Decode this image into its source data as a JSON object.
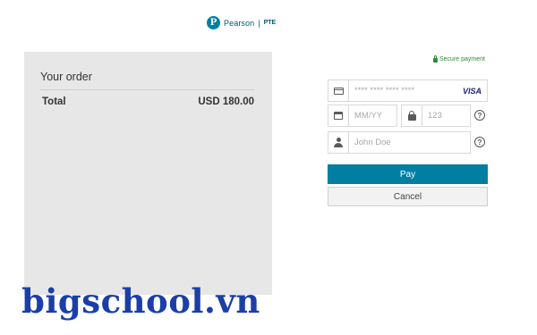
{
  "brand": {
    "logo_letter": "P",
    "name": "Pearson",
    "separator": "|",
    "product": "PTE"
  },
  "order": {
    "title": "Your order",
    "total_label": "Total",
    "total_value": "USD 180.00"
  },
  "payment": {
    "secure_label": "Secure payment",
    "card_placeholder": "**** **** **** ****",
    "card_brand": "VISA",
    "expiry_placeholder": "MM/YY",
    "cvv_placeholder": "123",
    "name_placeholder": "John Doe",
    "help_symbol": "?",
    "pay_label": "Pay",
    "cancel_label": "Cancel"
  },
  "watermark": "bigschool.vn",
  "colors": {
    "brand_teal": "#007fa3",
    "panel_gray": "#e7e7e7",
    "secure_green": "#2e8b3a",
    "watermark_blue": "#1b3fa8"
  },
  "icons": {
    "card": "credit-card-icon",
    "expiry": "calendar-icon",
    "cvv": "lock-icon",
    "name": "user-icon"
  }
}
